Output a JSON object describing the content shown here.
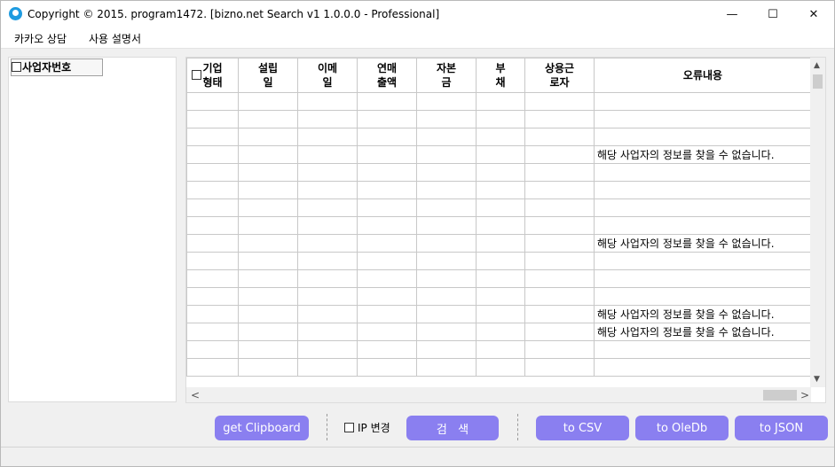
{
  "window": {
    "title": "Copyright © 2015. program1472. [bizno.net Search v1 1.0.0.0 - Professional]",
    "controls": {
      "minimize": "—",
      "maximize": "☐",
      "close": "✕"
    }
  },
  "menu": {
    "items": [
      "카카오 상담",
      "사용 설명서"
    ]
  },
  "left_panel": {
    "header": "사업자번호"
  },
  "grid": {
    "columns": [
      "기업\n형태",
      "설립\n일",
      "이메\n일",
      "연매\n출액",
      "자본\n금",
      "부\n채",
      "상용근\n로자",
      "오류내용"
    ],
    "rows": [
      [
        "",
        "",
        "",
        "",
        "",
        "",
        "",
        ""
      ],
      [
        "",
        "",
        "",
        "",
        "",
        "",
        "",
        ""
      ],
      [
        "",
        "",
        "",
        "",
        "",
        "",
        "",
        ""
      ],
      [
        "",
        "",
        "",
        "",
        "",
        "",
        "",
        "해당 사업자의 정보를 찾을 수 없습니다."
      ],
      [
        "",
        "",
        "",
        "",
        "",
        "",
        "",
        ""
      ],
      [
        "",
        "",
        "",
        "",
        "",
        "",
        "",
        ""
      ],
      [
        "",
        "",
        "",
        "",
        "",
        "",
        "",
        ""
      ],
      [
        "",
        "",
        "",
        "",
        "",
        "",
        "",
        ""
      ],
      [
        "",
        "",
        "",
        "",
        "",
        "",
        "",
        "해당 사업자의 정보를 찾을 수 없습니다."
      ],
      [
        "",
        "",
        "",
        "",
        "",
        "",
        "",
        ""
      ],
      [
        "",
        "",
        "",
        "",
        "",
        "",
        "",
        ""
      ],
      [
        "",
        "",
        "",
        "",
        "",
        "",
        "",
        ""
      ],
      [
        "",
        "",
        "",
        "",
        "",
        "",
        "",
        "해당 사업자의 정보를 찾을 수 없습니다."
      ],
      [
        "",
        "",
        "",
        "",
        "",
        "",
        "",
        "해당 사업자의 정보를 찾을 수 없습니다."
      ],
      [
        "",
        "",
        "",
        "",
        "",
        "",
        "",
        ""
      ],
      [
        "",
        "",
        "",
        "",
        "",
        "",
        "",
        ""
      ]
    ],
    "scroll": {
      "up": "▲",
      "down": "▼",
      "left": "<",
      "right": ">"
    }
  },
  "toolbar": {
    "clipboard_label": "get Clipboard",
    "ip_change_label": "IP 변경",
    "search_label": "검   색",
    "csv_label": "to CSV",
    "oledb_label": "to OleDb",
    "json_label": "to JSON"
  },
  "colors": {
    "button_bg": "#8a7ff0",
    "app_icon": "#1e9be0"
  }
}
